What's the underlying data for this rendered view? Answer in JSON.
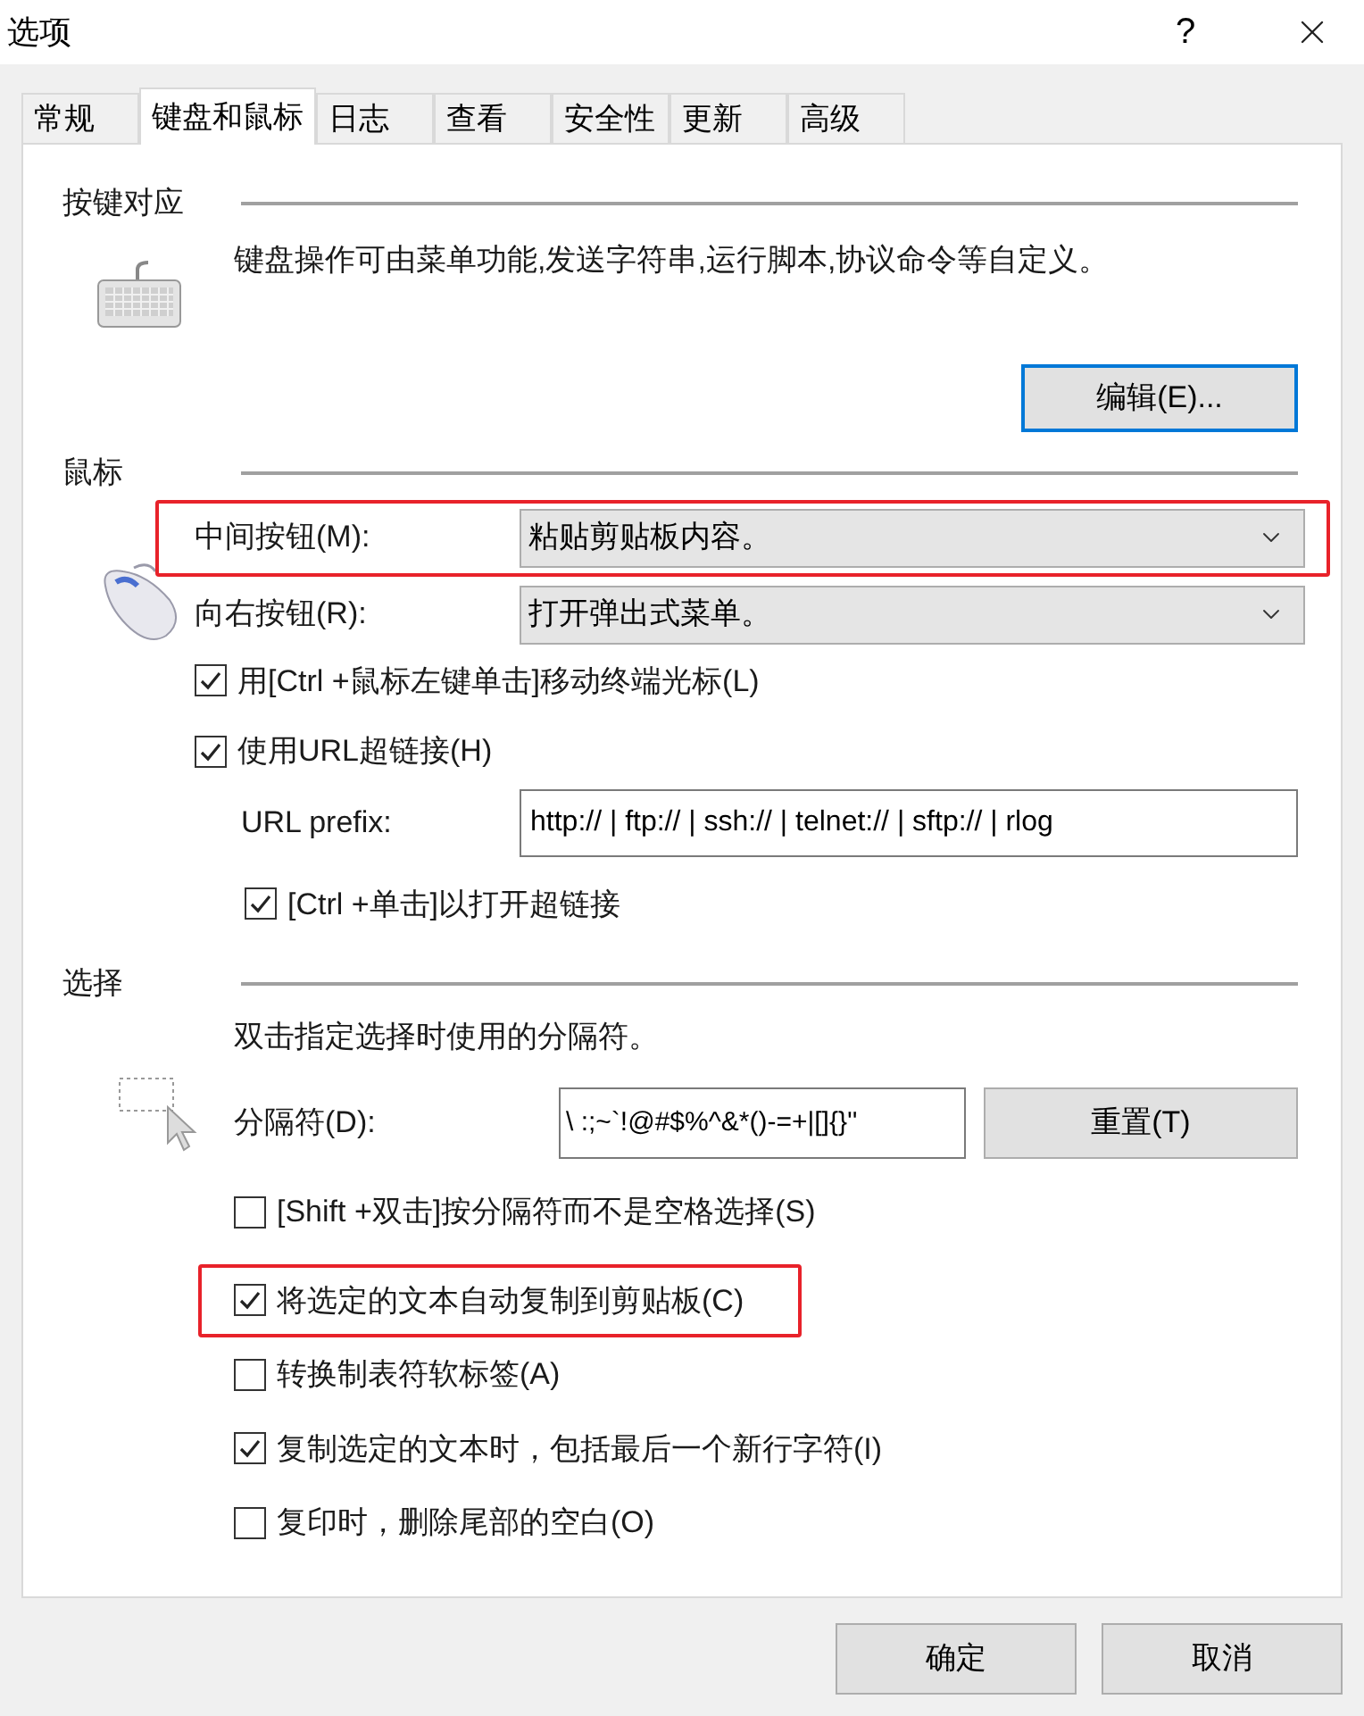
{
  "window": {
    "title": "选项",
    "help": "?"
  },
  "tabs": [
    {
      "label": "常规",
      "selected": false
    },
    {
      "label": "键盘和鼠标",
      "selected": true
    },
    {
      "label": "日志",
      "selected": false
    },
    {
      "label": "查看",
      "selected": false
    },
    {
      "label": "安全性",
      "selected": false
    },
    {
      "label": "更新",
      "selected": false
    },
    {
      "label": "高级",
      "selected": false
    }
  ],
  "key_mapping": {
    "heading": "按键对应",
    "description": "键盘操作可由菜单功能,发送字符串,运行脚本,协议命令等自定义。",
    "edit_button": "编辑(E)..."
  },
  "mouse": {
    "heading": "鼠标",
    "dropdowns": [
      {
        "label": "中间按钮(M):",
        "value": "粘贴剪贴板内容。",
        "highlighted": true
      },
      {
        "label": "向右按钮(R):",
        "value": "打开弹出式菜单。",
        "highlighted": false
      }
    ],
    "checkboxes": [
      {
        "label": "用[Ctrl +鼠标左键单击]移动终端光标(L)",
        "checked": true
      },
      {
        "label": "使用URL超链接(H)",
        "checked": true
      }
    ],
    "url_prefix": {
      "label": "URL prefix:",
      "value": "http:// | ftp:// | ssh:// | telnet:// | sftp:// | rlog"
    },
    "ctrl_click": {
      "label": "[Ctrl +单击]以打开超链接",
      "checked": true
    }
  },
  "selection": {
    "heading": "选择",
    "description": "双击指定选择时使用的分隔符。",
    "delimiter": {
      "label": "分隔符(D):",
      "value": "\\ :;~`!@#$%^&*()-=+|[]{}''"
    },
    "reset_button": "重置(T)",
    "options": [
      {
        "label": "[Shift +双击]按分隔符而不是空格选择(S)",
        "checked": false,
        "highlighted": false
      },
      {
        "label": "将选定的文本自动复制到剪贴板(C)",
        "checked": true,
        "highlighted": true
      },
      {
        "label": "转换制表符软标签(A)",
        "checked": false,
        "highlighted": false
      },
      {
        "label": "复制选定的文本时，包括最后一个新行字符(I)",
        "checked": true,
        "highlighted": false
      },
      {
        "label": "复印时，删除尾部的空白(O)",
        "checked": false,
        "highlighted": false
      }
    ]
  },
  "buttons": [
    "确定",
    "取消"
  ]
}
